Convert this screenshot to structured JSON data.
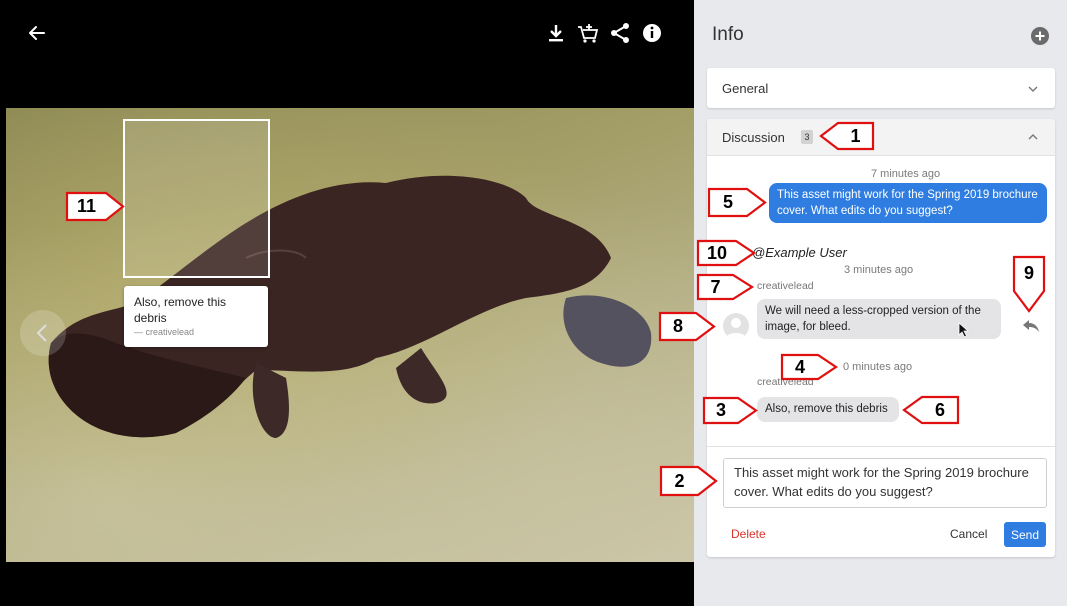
{
  "viewer": {
    "tools": [
      "download-icon",
      "add-to-cart-icon",
      "share-icon",
      "info-icon"
    ],
    "note": {
      "text": "Also, remove this debris",
      "author": "— creativelead"
    }
  },
  "panel": {
    "title": "Info",
    "general": {
      "label": "General"
    },
    "discussion": {
      "label": "Discussion",
      "count": "3",
      "messages": [
        {
          "time": "7 minutes ago",
          "text": "This asset might work for the Spring 2019 brochure cover. What edits do you suggest?"
        },
        {
          "mention": "@Example User",
          "time": "3 minutes ago",
          "author": "creativelead",
          "text": "We will need a less-cropped version of the image, for bleed."
        },
        {
          "time": "0 minutes ago",
          "author": "creativelead",
          "text": "Also, remove this debris"
        }
      ]
    },
    "composer": {
      "value": "This asset might work for the Spring 2019 brochure cover. What edits do you suggest?",
      "delete_label": "Delete",
      "cancel_label": "Cancel",
      "send_label": "Send"
    }
  },
  "callouts": [
    "1",
    "2",
    "3",
    "4",
    "5",
    "6",
    "7",
    "8",
    "9",
    "10",
    "11"
  ],
  "colors": {
    "accent": "#2f7de1",
    "danger": "#d9342b",
    "callout_border": "#e01010"
  }
}
